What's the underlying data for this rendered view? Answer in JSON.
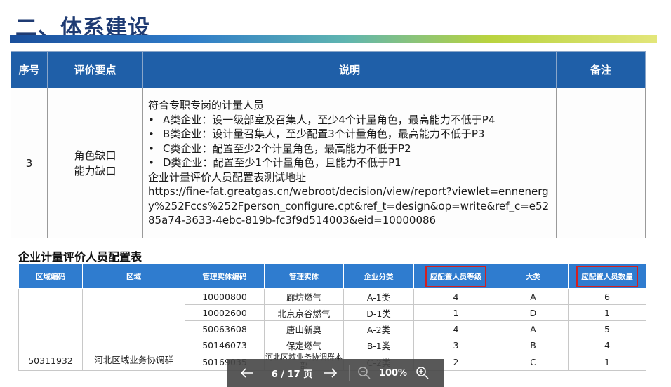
{
  "slide": {
    "title": "二、体系建设"
  },
  "main_table": {
    "headers": [
      "序号",
      "评价要点",
      "说明",
      "备注"
    ],
    "row": {
      "num": "3",
      "points": [
        "角色缺口",
        "能力缺口"
      ],
      "desc_intro": "符合专职专岗的计量人员",
      "bullets": [
        "A类企业：设一级部室及召集人，至少4个计量角色，最高能力不低于P4",
        "B类企业：设计量召集人，至少配置3个计量角色，最高能力不低于P3",
        "C类企业：配置至少2个计量角色，最高能力不低于P2",
        "D类企业：配置至少1个计量角色，且能力不低于P1"
      ],
      "url_label": "企业计量评价人员配置表测试地址",
      "url": "https://fine-fat.greatgas.cn/webroot/decision/view/report?viewlet=ennenergy%252Fccs%252Fperson_configure.cpt&ref_t=design&op=write&ref_c=e5285a74-3633-4ebc-819b-fc3f9d514003&eid=10000086",
      "note": ""
    }
  },
  "config_table": {
    "title": "企业计量评价人员配置表",
    "headers": [
      "区域编码",
      "区域",
      "管理实体编码",
      "管理实体",
      "企业分类",
      "应配置人员等级",
      "大类",
      "应配置人员数量"
    ],
    "region_code": "50311932",
    "region": "河北区域业务协调群",
    "rows": [
      {
        "code": "10000800",
        "entity": "廊坊燃气",
        "cls": "A-1类",
        "level": "4",
        "cat": "A",
        "count": "6"
      },
      {
        "code": "10002600",
        "entity": "北京京谷燃气",
        "cls": "D-1类",
        "level": "1",
        "cat": "D",
        "count": "1"
      },
      {
        "code": "50063608",
        "entity": "唐山新奥",
        "cls": "A-2类",
        "level": "4",
        "cat": "A",
        "count": "5"
      },
      {
        "code": "50146073",
        "entity": "保定燃气",
        "cls": "B-1类",
        "level": "3",
        "cat": "B",
        "count": "4"
      },
      {
        "code": "50169035",
        "entity": "河北区域业务协调群本部",
        "cls": "C-2类",
        "level": "2",
        "cat": "C",
        "count": "1"
      }
    ]
  },
  "viewer": {
    "page_label": "6 / 17 页",
    "zoom_label": "100%",
    "icons": [
      "arrow-left-icon",
      "arrow-right-icon",
      "zoom-out-icon",
      "zoom-in-icon"
    ],
    "highlight_color": "#d32020"
  }
}
